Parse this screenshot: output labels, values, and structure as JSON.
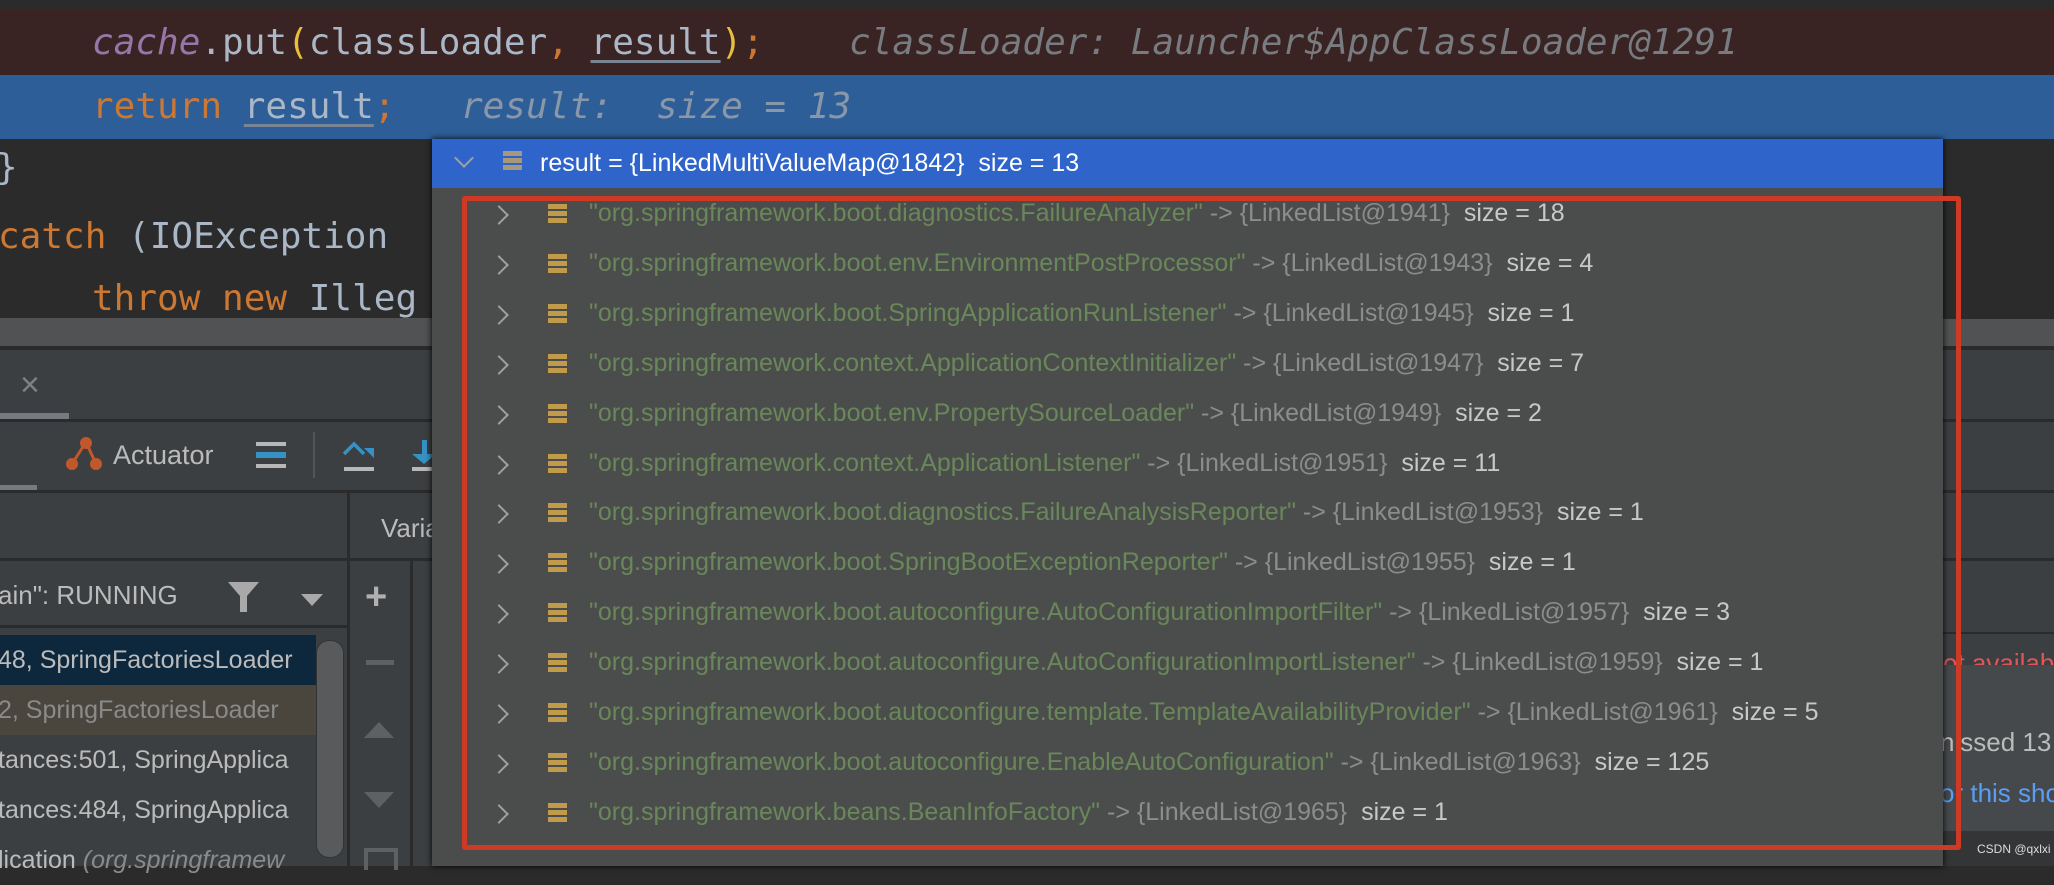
{
  "editor": {
    "line1": {
      "field": "cache",
      "call": ".put",
      "open": "(",
      "arg1": "classLoader",
      "comma": ", ",
      "arg2": "result",
      "close": ")",
      "semi": ";",
      "hint": "classLoader: Launcher$AppClassLoader@1291"
    },
    "line2": {
      "keyword": "return",
      "var": "result",
      "semi": ";",
      "hint": "result:  size = 13"
    },
    "line3": {
      "text": "}"
    },
    "line4": {
      "keyword": "catch",
      "rest": " (IOException"
    },
    "line5": {
      "keyword": "throw new",
      "rest": " Illeg"
    }
  },
  "debug_panel": {
    "tab_close": "×",
    "actuator_label": "Actuator",
    "variables_header": "Varia",
    "thread_selector": "ain\": RUNNING",
    "frames": [
      {
        "text": "48, SpringFactoriesLoader",
        "state": "selected"
      },
      {
        "text": "2, SpringFactoriesLoader",
        "state": "library"
      },
      {
        "text": "tances:501, SpringApplica",
        "state": "normal"
      },
      {
        "text": "tances:484, SpringApplica",
        "state": "normal"
      },
      {
        "text": "lication",
        "italic": " (org.springframew",
        "state": "normal"
      }
    ],
    "add_label": "+"
  },
  "popup": {
    "header": {
      "name": "result",
      "value": " = {LinkedMultiValueMap@1842}",
      "size": "size = 13"
    },
    "entries": [
      {
        "key": "\"org.springframework.boot.diagnostics.FailureAnalyzer\"",
        "ref": "{LinkedList@1941}",
        "size": "size = 18"
      },
      {
        "key": "\"org.springframework.boot.env.EnvironmentPostProcessor\"",
        "ref": "{LinkedList@1943}",
        "size": "size = 4"
      },
      {
        "key": "\"org.springframework.boot.SpringApplicationRunListener\"",
        "ref": "{LinkedList@1945}",
        "size": "size = 1"
      },
      {
        "key": "\"org.springframework.context.ApplicationContextInitializer\"",
        "ref": "{LinkedList@1947}",
        "size": "size = 7"
      },
      {
        "key": "\"org.springframework.boot.env.PropertySourceLoader\"",
        "ref": "{LinkedList@1949}",
        "size": "size = 2"
      },
      {
        "key": "\"org.springframework.context.ApplicationListener\"",
        "ref": "{LinkedList@1951}",
        "size": "size = 11"
      },
      {
        "key": "\"org.springframework.boot.diagnostics.FailureAnalysisReporter\"",
        "ref": "{LinkedList@1953}",
        "size": "size = 1"
      },
      {
        "key": "\"org.springframework.boot.SpringBootExceptionReporter\"",
        "ref": "{LinkedList@1955}",
        "size": "size = 1"
      },
      {
        "key": "\"org.springframework.boot.autoconfigure.AutoConfigurationImportFilter\"",
        "ref": "{LinkedList@1957}",
        "size": "size = 3"
      },
      {
        "key": "\"org.springframework.boot.autoconfigure.AutoConfigurationImportListener\"",
        "ref": "{LinkedList@1959}",
        "size": "size = 1"
      },
      {
        "key": "\"org.springframework.boot.autoconfigure.template.TemplateAvailabilityProvider\"",
        "ref": "{LinkedList@1961}",
        "size": "size = 5"
      },
      {
        "key": "\"org.springframework.boot.autoconfigure.EnableAutoConfiguration\"",
        "ref": "{LinkedList@1963}",
        "size": "size = 125"
      },
      {
        "key": "\"org.springframework.beans.BeanInfoFactory\"",
        "ref": "{LinkedList@1965}",
        "size": "size = 1"
      }
    ],
    "arrow": " -> "
  },
  "right_side": {
    "error_text": "ot availab",
    "notice_text": "nissed 13",
    "link_text": "or this sho",
    "watermark": "CSDN @qxlxi"
  },
  "colors": {
    "highlight_box": "#cf3a24",
    "popup_header": "#2f65ca",
    "string": "#6a8759",
    "execution_line": "#2d5e98",
    "breakpoint_line": "#3a2323"
  }
}
